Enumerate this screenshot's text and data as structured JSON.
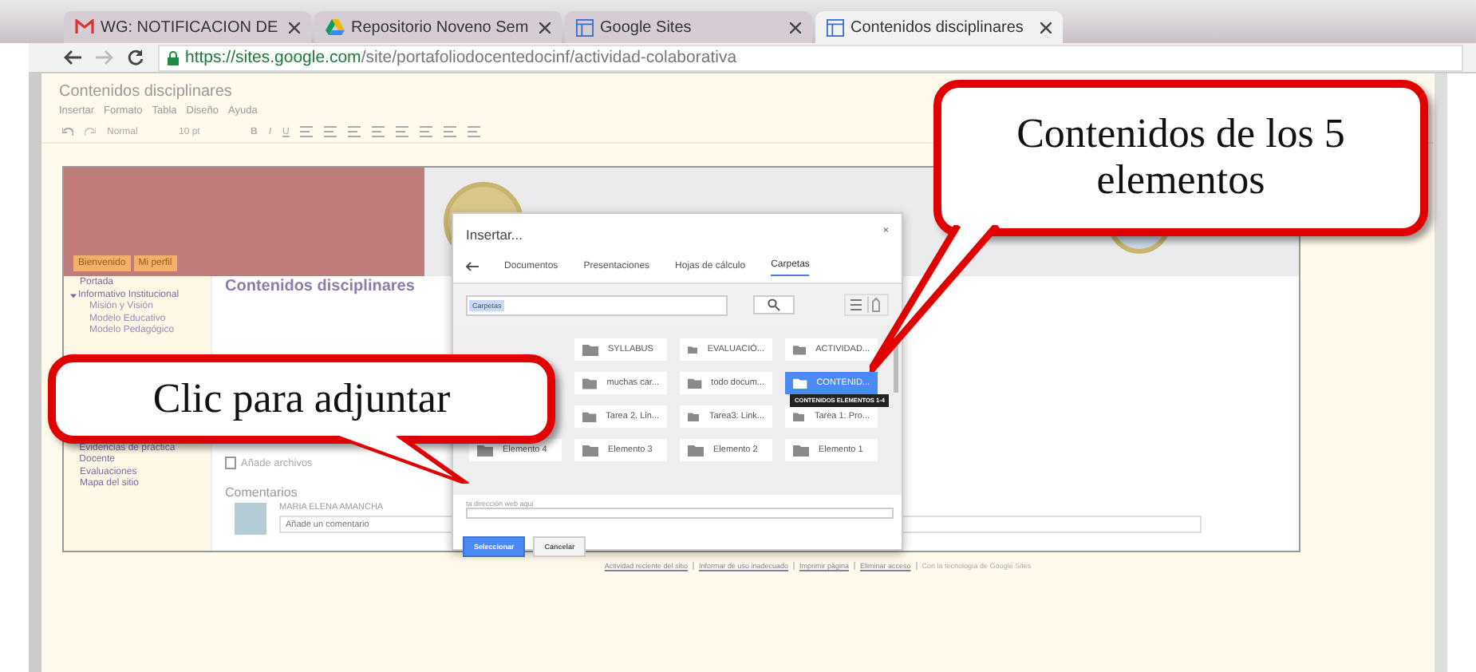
{
  "browser": {
    "tabs": [
      {
        "title": "WG: NOTIFICACION DE",
        "selected": false
      },
      {
        "title": "Repositorio Noveno Sem",
        "selected": false
      },
      {
        "title": "Google Sites",
        "selected": false
      },
      {
        "title": "Contenidos disciplinares",
        "selected": true
      }
    ],
    "url_host": "https://sites.google.com",
    "url_path": "/site/portafoliodocentedocinf/actividad-colaborativa"
  },
  "editor": {
    "title": "Contenidos disciplinares",
    "menu": [
      "Insertar",
      "Formato",
      "Tabla",
      "Diseño",
      "Ayuda"
    ],
    "font": "Normal",
    "size": "10 pt",
    "format_buttons": [
      "B",
      "I",
      "U"
    ]
  },
  "site": {
    "nav_buttons": [
      "Bienvenido",
      "Mi perfil"
    ],
    "sidebar": [
      {
        "label": "Portada",
        "expanded": false
      },
      {
        "label": "Informativo Institucional",
        "expanded": true,
        "children": [
          {
            "label": "Misión y Visión"
          },
          {
            "label": "Modelo Educativo"
          },
          {
            "label": "Modelo Pedagógico"
          }
        ]
      },
      {
        "label": "Evidencias de práctica Docente",
        "expanded": false
      },
      {
        "label": "Evaluaciones",
        "expanded": false
      },
      {
        "label": "Mapa del sitio",
        "expanded": false
      }
    ],
    "page_title": "Contenidos disciplinares",
    "attach_link": "Añade archivos",
    "comments": {
      "heading": "Comentarios",
      "author": "MARIA ELENA AMANCHA",
      "placeholder": "Añade un comentario"
    },
    "footer": [
      "Actividad reciente del sitio",
      "Informar de uso inadecuado",
      "Imprimir página",
      "Eliminar acceso",
      "Con la tecnología de Google Sites"
    ]
  },
  "dialog": {
    "title": "Insertar...",
    "close": "×",
    "tabs": [
      {
        "label": "Documentos",
        "selected": false
      },
      {
        "label": "Presentaciones",
        "selected": false
      },
      {
        "label": "Hojas de cálculo",
        "selected": false
      },
      {
        "label": "Carpetas",
        "selected": true
      }
    ],
    "search_chip": "Carpetas",
    "folders": [
      {
        "name": "SYLLABUS",
        "selected": false
      },
      {
        "name": "EVALUACIÓ...",
        "selected": false
      },
      {
        "name": "ACTIVIDAD...",
        "selected": false
      },
      {
        "name": "muchas car...",
        "selected": false
      },
      {
        "name": "todo docum...",
        "selected": false
      },
      {
        "name": "CONTENID...",
        "selected": true
      },
      {
        "name": "Tarea 2. Lin...",
        "selected": false
      },
      {
        "name": "Tarea3: Link...",
        "selected": false
      },
      {
        "name": "Tarea 1: Pro...",
        "selected": false
      },
      {
        "name": "Elemento 4",
        "selected": false
      },
      {
        "name": "Elemento 3",
        "selected": false
      },
      {
        "name": "Elemento 2",
        "selected": false
      },
      {
        "name": "Elemento 1",
        "selected": false
      }
    ],
    "tooltip": "CONTENIDOS ELEMENTOS 1-4",
    "url_label": "ta dirección web aquí",
    "buttons": [
      {
        "label": "Seleccionar",
        "kind": "primary"
      },
      {
        "label": "Cancelar",
        "kind": "secondary"
      }
    ]
  },
  "callouts": [
    {
      "text": "Contenidos de los 5 elementos"
    },
    {
      "text": "Clic para adjuntar"
    }
  ]
}
